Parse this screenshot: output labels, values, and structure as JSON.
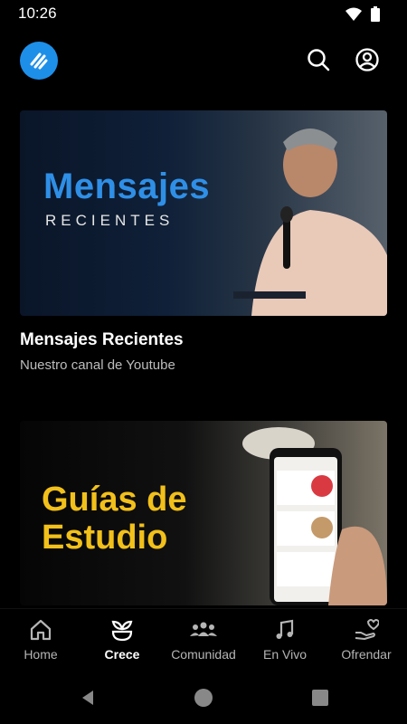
{
  "status": {
    "time": "10:26"
  },
  "app": {
    "brand_color": "#1e8fe8"
  },
  "cards": [
    {
      "banner_title": "Mensajes",
      "banner_subtitle": "RECIENTES",
      "title": "Mensajes Recientes",
      "subtitle": "Nuestro canal de Youtube"
    },
    {
      "banner_title_line1": "Guías de",
      "banner_title_line2": "Estudio"
    }
  ],
  "bottom_nav": {
    "items": [
      {
        "label": "Home",
        "icon": "home-icon"
      },
      {
        "label": "Crece",
        "icon": "plant-icon",
        "active": true
      },
      {
        "label": "Comunidad",
        "icon": "community-icon"
      },
      {
        "label": "En Vivo",
        "icon": "music-icon"
      },
      {
        "label": "Ofrendar",
        "icon": "give-icon"
      }
    ]
  }
}
